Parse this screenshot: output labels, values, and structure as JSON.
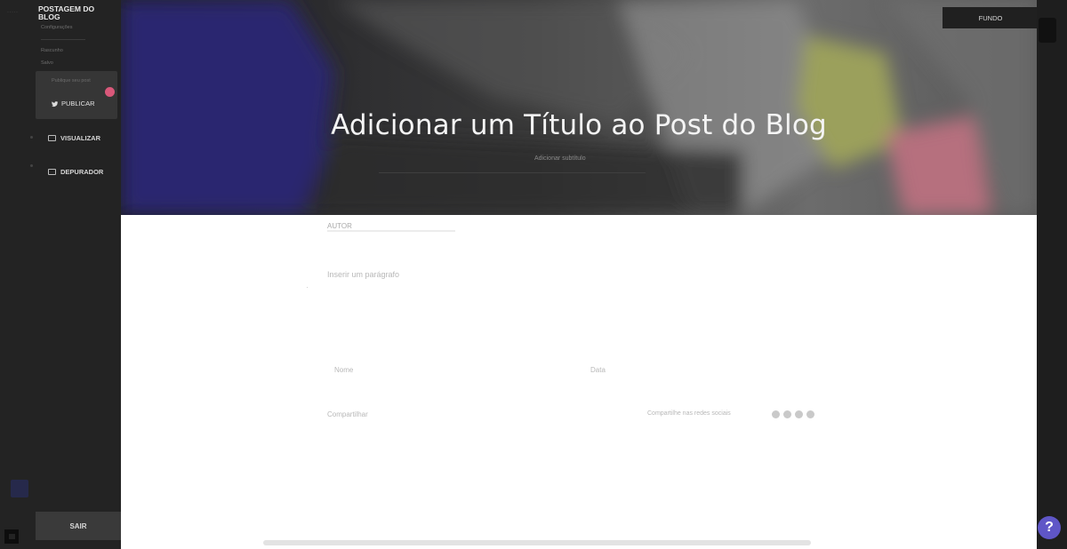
{
  "sidebar": {
    "title": "POSTAGEM DO BLOG",
    "faint_labels": [
      "Configurações",
      "Rascunho",
      "Salvo"
    ],
    "publish_sub": "Publique seu post",
    "publish_label": "PUBLICAR",
    "nav": [
      {
        "label": "VISUALIZAR",
        "icon": "preview-icon"
      },
      {
        "label": "DEPURADOR",
        "icon": "debug-icon"
      }
    ],
    "exit_label": "SAIR"
  },
  "hero": {
    "title": "Adicionar um Título ao Post do Blog",
    "subtitle": "Adicionar subtítulo",
    "topright_label": "FUNDO"
  },
  "content": {
    "author": "AUTOR",
    "placeholder": "Inserir um parágrafo",
    "meta_left": "Nome",
    "meta_right": "Data",
    "footer_left": "Compartilhar",
    "footer_right": "Compartilhe nas redes sociais",
    "social_icons": [
      "facebook-icon",
      "twitter-icon",
      "linkedin-icon",
      "pinterest-icon"
    ]
  },
  "help_label": "?",
  "colors": {
    "accent": "#5f56c7",
    "badge": "#d9587a",
    "hero_blue": "#2a2870",
    "hero_yellow": "#9ba05c",
    "hero_pink": "#b6707e"
  }
}
